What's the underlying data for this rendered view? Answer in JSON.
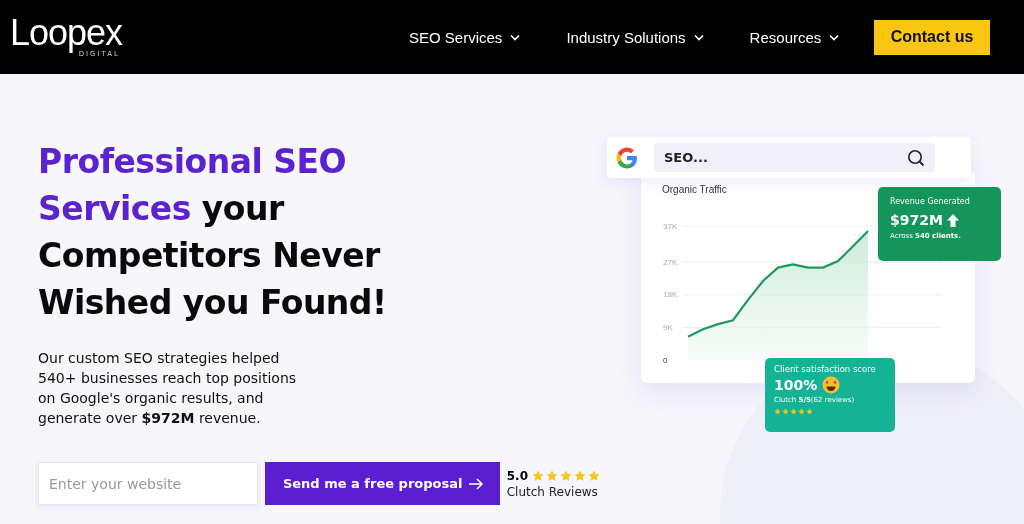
{
  "nav": {
    "logo": "Loopex",
    "logo_sub": "DIGITAL",
    "items": [
      {
        "label": "SEO Services",
        "dropdown": true
      },
      {
        "label": "Industry Solutions",
        "dropdown": true
      },
      {
        "label": "Resources",
        "dropdown": true
      }
    ],
    "cta": "Contact us"
  },
  "hero": {
    "headline": [
      {
        "text": "Professional SEO",
        "accent": true
      },
      {
        "text": "Services",
        "accent": true,
        "rest": " your"
      },
      {
        "text": "Competitors Never",
        "accent": false
      },
      {
        "text": "Wished you Found!",
        "accent": false
      }
    ],
    "paragraph": "Our custom SEO strategies helped 540+ businesses reach top positions on Google's organic results, and generate over **$972M** revenue.",
    "input": {
      "placeholder": "Enter your website"
    },
    "button": "Send me a free proposal",
    "rating": {
      "score": "5.0",
      "stars": 5,
      "label": "Clutch Reviews"
    }
  },
  "illustration": {
    "search": {
      "value": "SEO..."
    },
    "traffic": {
      "chart_data": {
        "type": "area",
        "title": "Organic Traffic",
        "grid": true,
        "categories": [
          null,
          null,
          null,
          null,
          null,
          null,
          null,
          null,
          null,
          null,
          null,
          null,
          null,
          null,
          null,
          null,
          null,
          null
        ],
        "series": [
          {
            "color": "#1f9a5c",
            "values": [
              6.4,
              8.5,
              9.9,
              11,
              16.6,
              21.8,
              25.5,
              26.4,
              25.5,
              25.5,
              27.3,
              31.4,
              35.6,
              null,
              null,
              null,
              null,
              null
            ]
          }
        ],
        "yticks": [
          0,
          {
            "value": 9,
            "label": "9K"
          },
          {
            "value": 18,
            "label": "18K"
          },
          {
            "value": 27,
            "label": "27K"
          },
          {
            "value": 37,
            "label": "37K"
          }
        ],
        "ylim": [
          0,
          37
        ]
      }
    },
    "revenue": {
      "title": "Revenue Generated",
      "value": "$972M",
      "note": "Across **540 clients.**"
    },
    "satisfaction": {
      "title": "Client satisfaction score",
      "value": "100%",
      "note": "Clutch **5/5**(62 reviews)",
      "stars": 5
    }
  }
}
